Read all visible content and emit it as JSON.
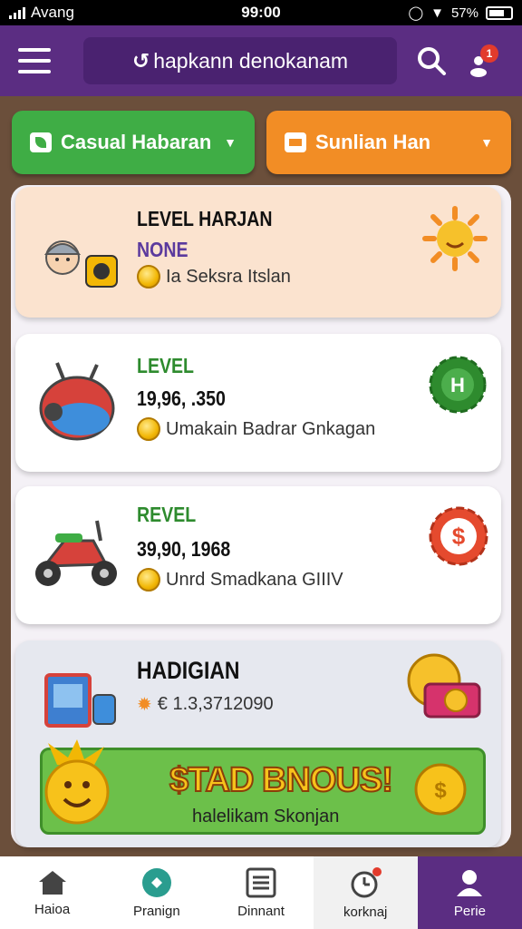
{
  "status_bar": {
    "carrier": "Avang",
    "time": "99:00",
    "battery_text": "57%"
  },
  "app_bar": {
    "title": "hapkann denokanam",
    "notification_count": "1"
  },
  "filters": {
    "category": {
      "label": "Casual Habaran",
      "color": "#3fad45"
    },
    "sort": {
      "label": "Sunlian Han",
      "color": "#f28d25"
    }
  },
  "cards": [
    {
      "title": "LEVEL HARJAN",
      "subtitle": "NONE",
      "subtitle_color": "#5b3a9e",
      "line": "Ia Seksra Itslan"
    },
    {
      "title": "LEVEL",
      "title_color": "#2e8b2e",
      "subtitle": "19,96, .350",
      "line": "Umakain Badrar Gnkagan"
    },
    {
      "title": "REVEL",
      "title_color": "#2e8b2e",
      "subtitle": "39,90, 1968",
      "line": "Unrd Smadkana GIIIV"
    },
    {
      "title": "HADIGIAN",
      "subtitle": "€ 1.3,3712090"
    }
  ],
  "bonus": {
    "title": "$TAD BNOUS!",
    "subtitle": "halelikam Skonjan"
  },
  "nav": [
    {
      "label": "Haioa",
      "icon": "home-icon"
    },
    {
      "label": "Pranign",
      "icon": "play-circle-icon"
    },
    {
      "label": "Dinnant",
      "icon": "list-icon"
    },
    {
      "label": "korknaj",
      "icon": "alarm-icon"
    },
    {
      "label": "Perie",
      "icon": "profile-icon"
    }
  ],
  "colors": {
    "primary": "#5b2d82",
    "green": "#3fad45",
    "orange": "#f28d25",
    "badge": "#e23b2c"
  }
}
